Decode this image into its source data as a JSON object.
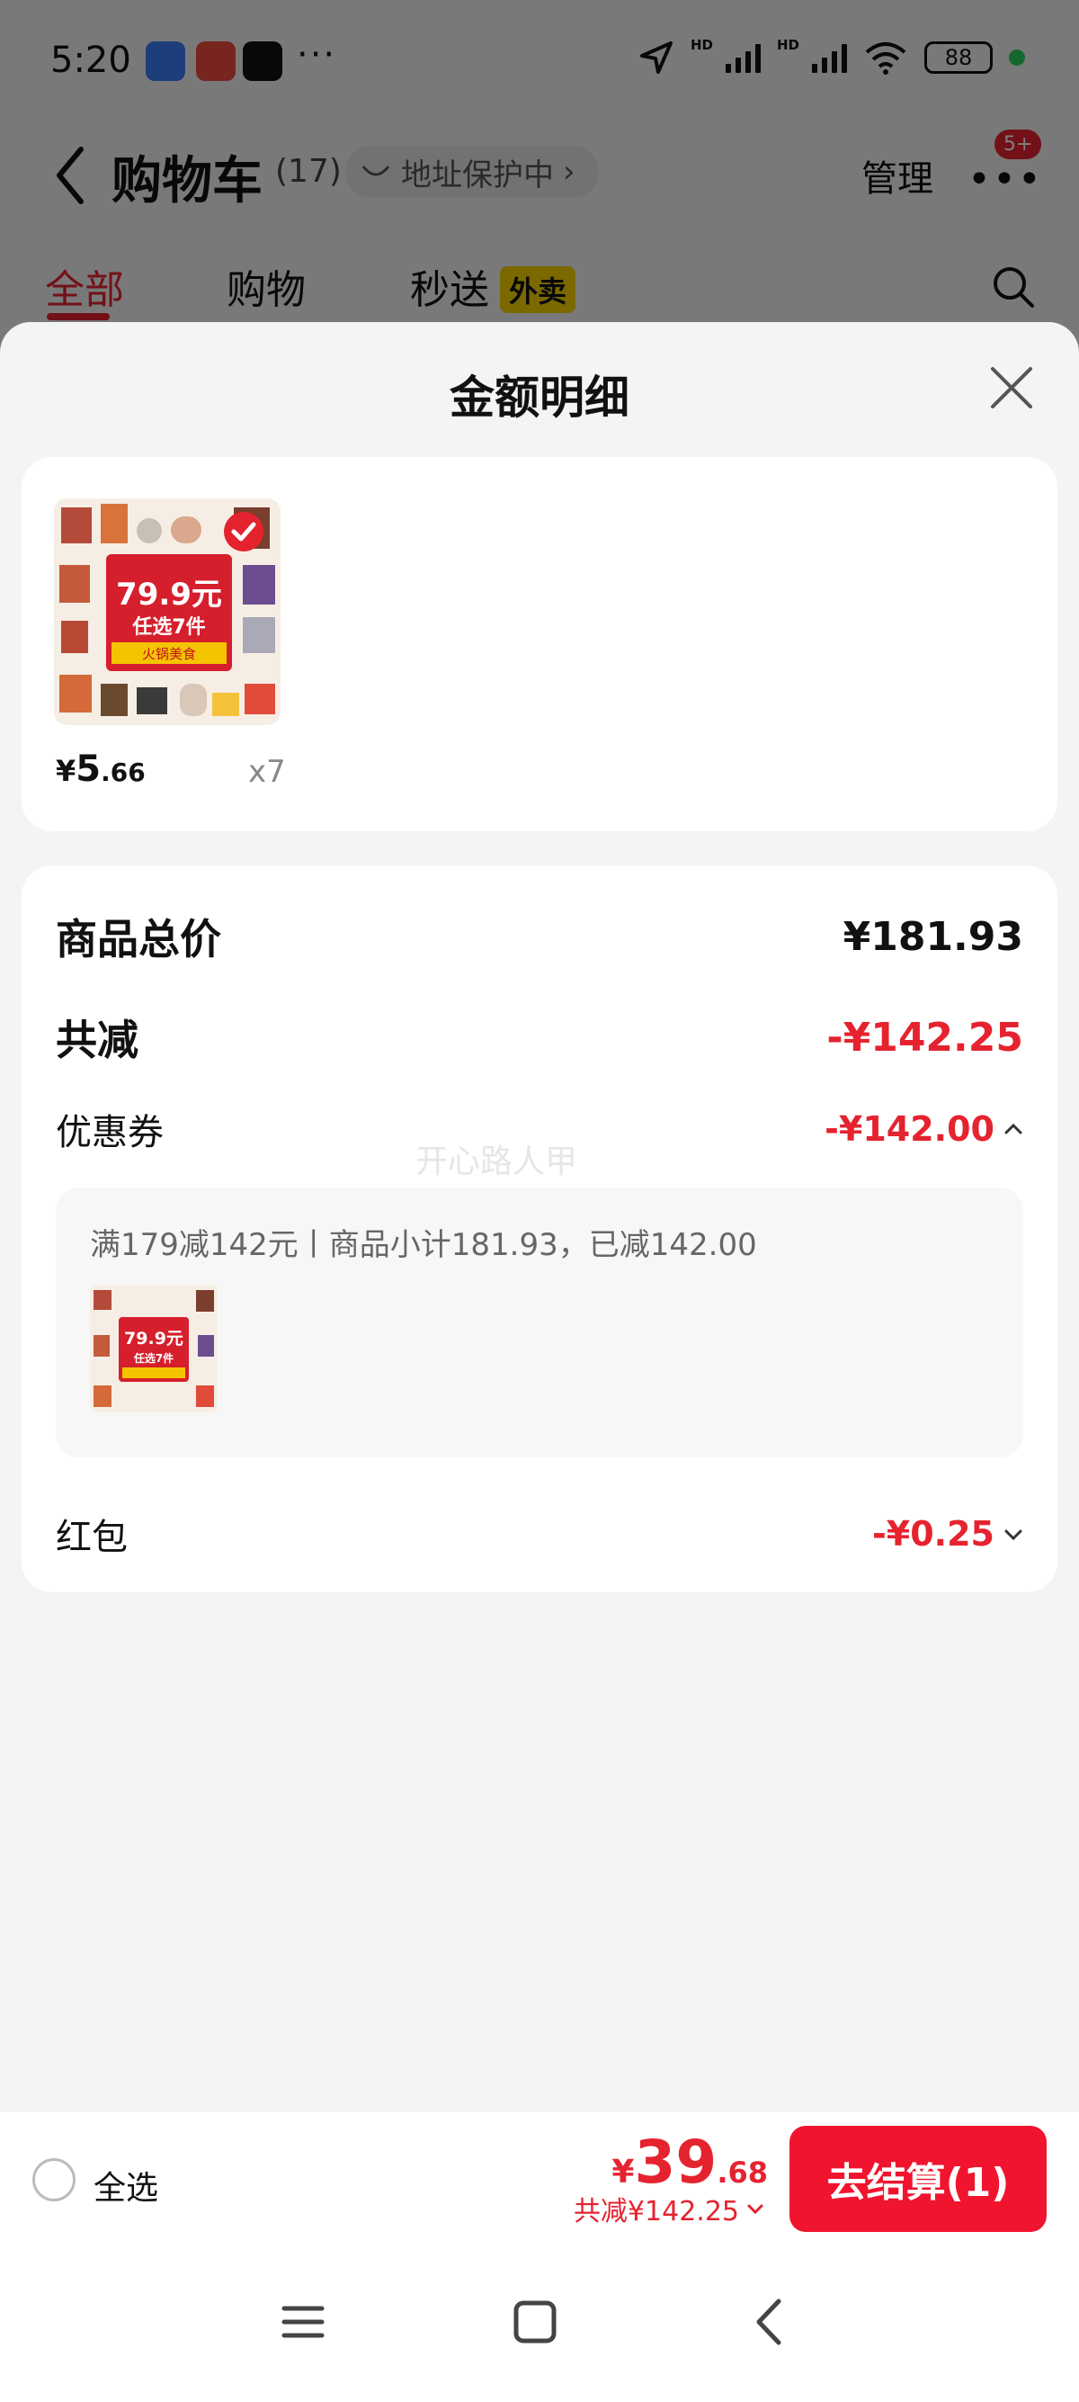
{
  "status_bar": {
    "time": "5:20",
    "more": "···",
    "hd1": "HD",
    "hd2": "HD",
    "battery": "88"
  },
  "navbar": {
    "title": "购物车",
    "count": "(17)",
    "address_protect": "地址保护中",
    "address_arrow": "›",
    "manage": "管理",
    "more": "•••",
    "badge": "5+"
  },
  "tabs": [
    {
      "label": "全部",
      "active": true
    },
    {
      "label": "购物",
      "active": false
    },
    {
      "label": "秒送",
      "active": false
    }
  ],
  "tab_tag": "外卖",
  "sheet": {
    "title": "金额明细"
  },
  "product": {
    "currency": "¥",
    "price_int": "5",
    "price_dec": ".66",
    "quantity": "x7",
    "image_text_big": "79.9元",
    "image_text_sub": "任选7件",
    "image_text_tag": "火锅美食"
  },
  "details": {
    "total_label": "商品总价",
    "total_value": "¥181.93",
    "reduction_label": "共减",
    "reduction_value": "-¥142.25",
    "coupon_label": "优惠券",
    "coupon_value": "-¥142.00",
    "coupon_rule": "满179减142元丨商品小计181.93，已减142.00",
    "redpacket_label": "红包",
    "redpacket_value": "-¥0.25"
  },
  "watermark": "开心路人甲",
  "bottom_bar": {
    "select_all": "全选",
    "currency": "¥",
    "total_int": "39",
    "total_dec": ".68",
    "saved": "共减¥142.25",
    "checkout": "去结算(1)"
  },
  "colors": {
    "accent_red": "#e5232f",
    "checkout_red": "#f0142f",
    "tag_yellow": "#f7d300"
  }
}
